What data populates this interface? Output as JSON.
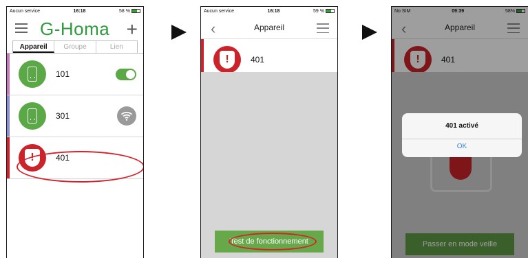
{
  "screen1": {
    "status": {
      "carrier": "Aucun service",
      "time": "16:18",
      "battery": "58 %"
    },
    "brand": {
      "title": "G-Homa"
    },
    "tabs": [
      {
        "label": "Appareil"
      },
      {
        "label": "Groupe"
      },
      {
        "label": "Lien"
      }
    ],
    "devices": [
      {
        "label": "101",
        "accent": "#c77ab8",
        "toggle_on": true
      },
      {
        "label": "301",
        "accent": "#8b8ed0"
      },
      {
        "label": "401",
        "accent": "#cc2229"
      }
    ]
  },
  "screen2": {
    "status": {
      "carrier": "Aucun service",
      "time": "16:18",
      "battery": "59 %"
    },
    "nav": {
      "title": "Appareil"
    },
    "device": {
      "label": "401"
    },
    "action_button": "Test de fonctionnement"
  },
  "screen3": {
    "status": {
      "carrier": "No SIM",
      "time": "09:39",
      "battery": "58%"
    },
    "nav": {
      "title": "Appareil"
    },
    "device": {
      "label": "401"
    },
    "dialog": {
      "title": "401 activé",
      "ok": "OK"
    },
    "action_button": "Passer en mode veille"
  },
  "colors": {
    "brand_green": "#2f9a3e",
    "alarm_red": "#cc2229",
    "highlight_red": "#d7202a"
  }
}
